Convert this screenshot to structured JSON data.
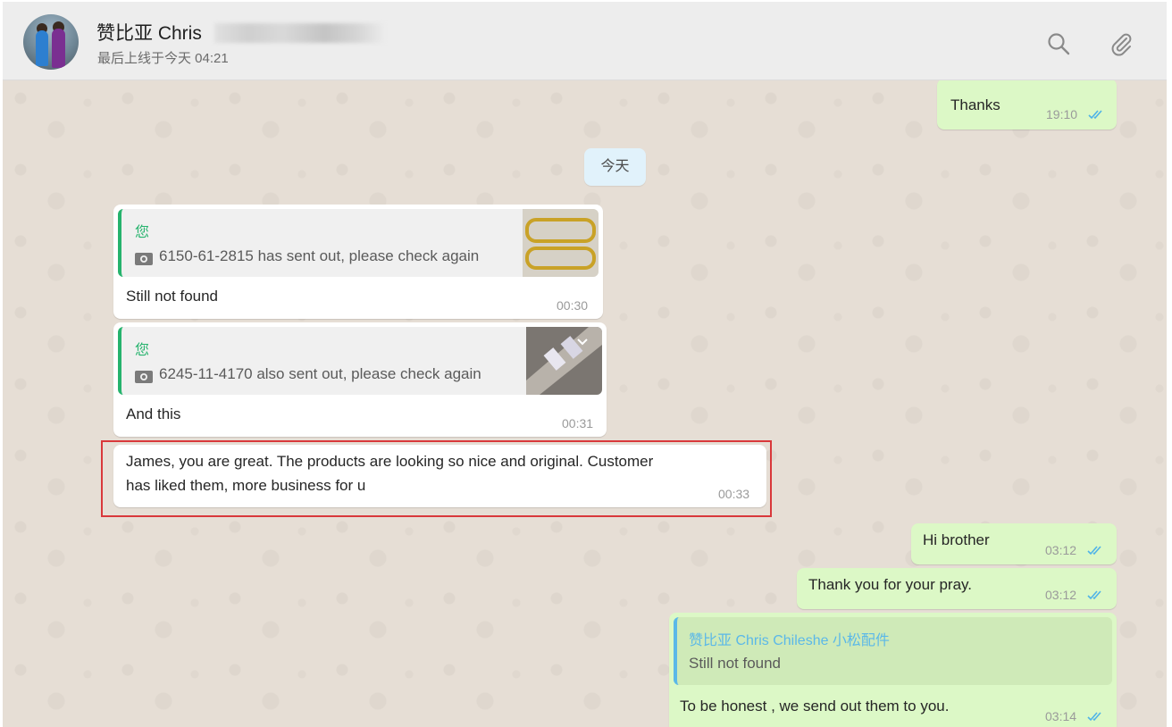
{
  "header": {
    "contact_name": "赞比亚 Chris",
    "last_seen": "最后上线于今天 04:21",
    "icons": [
      "search-icon",
      "attach-icon"
    ]
  },
  "colors": {
    "header_bg": "#ededed",
    "chat_bg": "#e6ded5",
    "incoming_bubble": "#ffffff",
    "outgoing_bubble": "#dcf8c6",
    "quote_accent": "#26b36d",
    "reply_accent": "#5bb8e8",
    "read_ticks": "#4fb3e8",
    "highlight_border": "#d9383b"
  },
  "messages": [
    {
      "direction": "out",
      "text": "Thanks",
      "time": "19:10"
    },
    {
      "type": "date",
      "text": "今天"
    },
    {
      "direction": "in",
      "quote": {
        "author": "您",
        "icon": "camera-icon",
        "text": "6150-61-2815 has sent out, please check again"
      },
      "text": "Still not found",
      "time": "00:30"
    },
    {
      "direction": "in",
      "quote": {
        "author": "您",
        "icon": "camera-icon",
        "text": "6245-11-4170 also sent out, please check again"
      },
      "text": "And this",
      "time": "00:31"
    },
    {
      "direction": "in",
      "text_line1": "James, you are great. The products are looking so nice and original. Customer",
      "text_line2": "has liked them, more business for u",
      "time": "00:33",
      "highlighted": true
    },
    {
      "direction": "out",
      "text": "Hi brother",
      "time": "03:12"
    },
    {
      "direction": "out",
      "text": "Thank you for your pray.",
      "time": "03:12"
    },
    {
      "direction": "out",
      "reply": {
        "author": "赞比亚 Chris Chileshe 小松配件",
        "text": "Still not found"
      },
      "text": "To be honest , we send out them to you.",
      "time": "03:14"
    }
  ]
}
